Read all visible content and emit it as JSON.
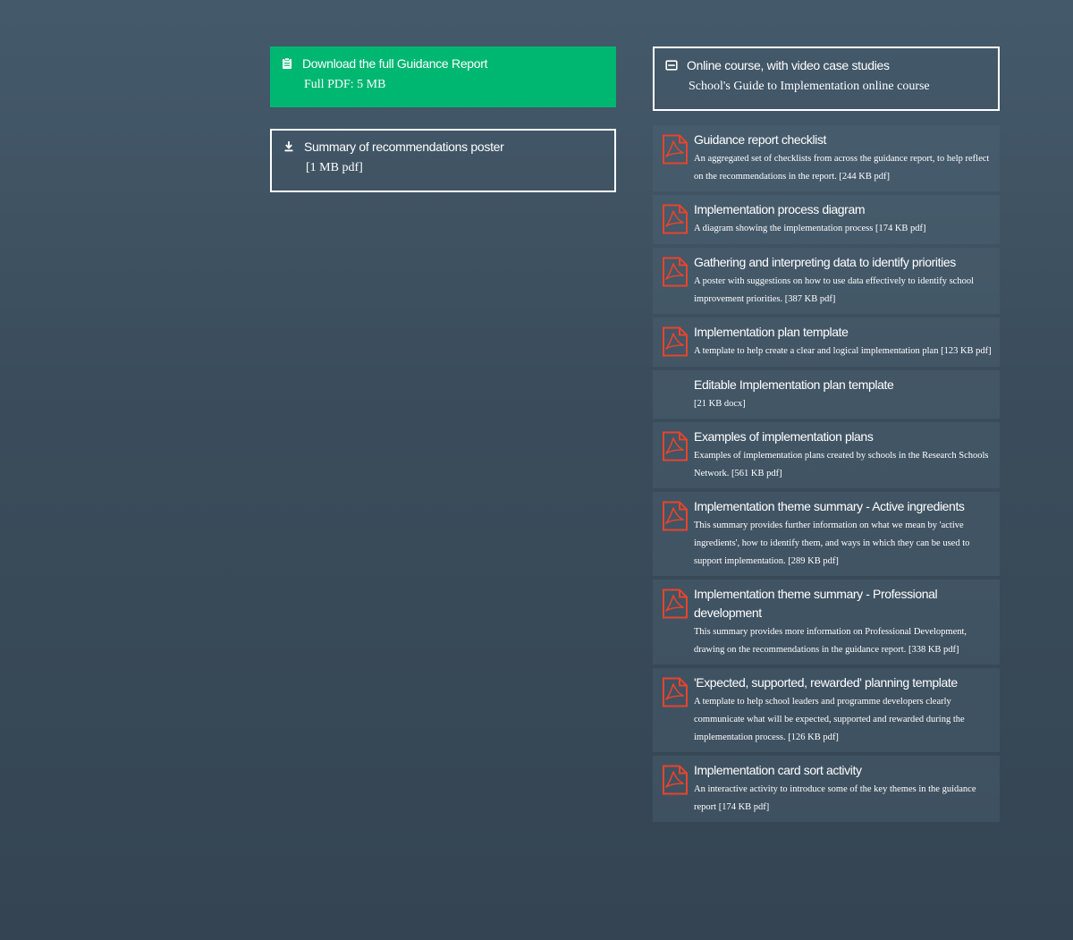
{
  "downloads": {
    "full_report": {
      "title": "Download the full Guidance Report",
      "sub": "Full PDF: 5 MB"
    },
    "poster": {
      "title": "Summary of recommendations poster",
      "sub": "[1 MB pdf]"
    }
  },
  "online_course": {
    "title": "Online course, with video case studies",
    "sub": "School's Guide to Implementation online course"
  },
  "resources": [
    {
      "title": "Guidance report checklist",
      "desc": "An aggregated set of checklists from across the guidance report, to help reflect on the recommendations in the report. [244 KB pdf]",
      "icon": "pdf-icon"
    },
    {
      "title": "Implementation process diagram",
      "desc": "A diagram showing the implementation process [174 KB pdf]",
      "icon": "pdf-icon"
    },
    {
      "title": "Gathering and interpreting data to identify priorities",
      "desc": "A poster with suggestions on how to use data effectively to identify school improvement priorities. [387 KB pdf]",
      "icon": "pdf-icon"
    },
    {
      "title": "Implementation plan template",
      "desc": "A template to help create a clear and logical implementation plan [123 KB pdf]",
      "icon": "pdf-icon"
    },
    {
      "title": "Editable Implementation plan template",
      "desc": "[21 KB docx]",
      "icon": ""
    },
    {
      "title": "Examples of implementation plans",
      "desc": "Examples of implementation plans created by schools in the Research Schools Network. [561 KB pdf]",
      "icon": "pdf-icon"
    },
    {
      "title": "Implementation theme summary - Active ingredients",
      "desc": "This summary provides further information on what we mean by 'active ingredients', how to identify them, and ways in which they can be used to support implementation. [289 KB pdf]",
      "icon": "pdf-icon"
    },
    {
      "title": "Implementation theme summary - Professional development",
      "desc": "This summary provides more information on Professional Development, drawing on the recommendations in the guidance report. [338 KB pdf]",
      "icon": "pdf-icon"
    },
    {
      "title": "'Expected, supported, rewarded' planning template",
      "desc": "A template to help school leaders and programme developers clearly communicate what will be expected, supported and rewarded during the implementation process. [126 KB pdf]",
      "icon": "pdf-icon"
    },
    {
      "title": "Implementation card sort activity",
      "desc": "An interactive activity to introduce some of the key themes in the guidance report [174 KB pdf]",
      "icon": "pdf-icon"
    }
  ],
  "colors": {
    "background": "#3b4d5c",
    "green_button": "#00b772",
    "pdf_icon": "#e8442b"
  }
}
